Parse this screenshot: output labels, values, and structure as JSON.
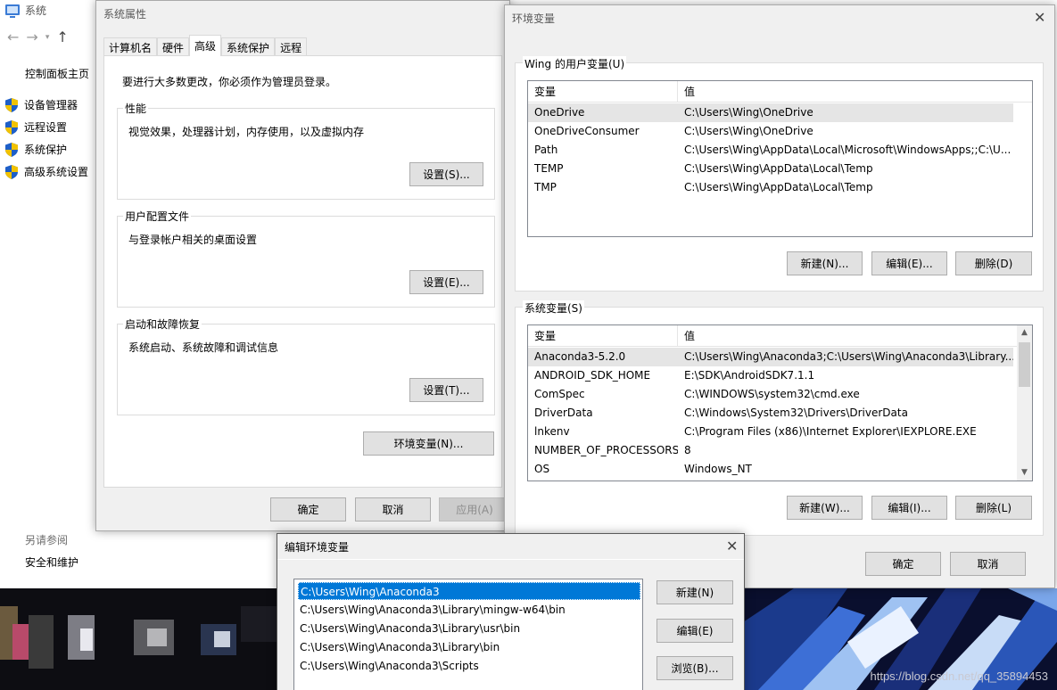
{
  "control_panel": {
    "title": "系统",
    "home_link": "控制面板主页",
    "links": [
      "设备管理器",
      "远程设置",
      "系统保护",
      "高级系统设置"
    ],
    "see_also": "另请参阅",
    "security_link": "安全和维护"
  },
  "system_properties": {
    "title": "系统属性",
    "tabs": [
      "计算机名",
      "硬件",
      "高级",
      "系统保护",
      "远程"
    ],
    "active_tab": "高级",
    "admin_note": "要进行大多数更改，你必须作为管理员登录。",
    "performance": {
      "label": "性能",
      "description": "视觉效果，处理器计划，内存使用，以及虚拟内存",
      "button": "设置(S)..."
    },
    "user_profiles": {
      "label": "用户配置文件",
      "description": "与登录帐户相关的桌面设置",
      "button": "设置(E)..."
    },
    "startup_recovery": {
      "label": "启动和故障恢复",
      "description": "系统启动、系统故障和调试信息",
      "button": "设置(T)..."
    },
    "env_button": "环境变量(N)...",
    "ok": "确定",
    "cancel": "取消",
    "apply": "应用(A)"
  },
  "environment_variables": {
    "title": "环境变量",
    "user_section": "Wing 的用户变量(U)",
    "user_headers": {
      "variable": "变量",
      "value": "值"
    },
    "user_vars": [
      {
        "name": "OneDrive",
        "value": "C:\\Users\\Wing\\OneDrive"
      },
      {
        "name": "OneDriveConsumer",
        "value": "C:\\Users\\Wing\\OneDrive"
      },
      {
        "name": "Path",
        "value": "C:\\Users\\Wing\\AppData\\Local\\Microsoft\\WindowsApps;;C:\\U..."
      },
      {
        "name": "TEMP",
        "value": "C:\\Users\\Wing\\AppData\\Local\\Temp"
      },
      {
        "name": "TMP",
        "value": "C:\\Users\\Wing\\AppData\\Local\\Temp"
      }
    ],
    "user_buttons": {
      "new": "新建(N)...",
      "edit": "编辑(E)...",
      "delete": "删除(D)"
    },
    "system_section": "系统变量(S)",
    "system_headers": {
      "variable": "变量",
      "value": "值"
    },
    "system_vars": [
      {
        "name": "Anaconda3-5.2.0",
        "value": "C:\\Users\\Wing\\Anaconda3;C:\\Users\\Wing\\Anaconda3\\Library..."
      },
      {
        "name": "ANDROID_SDK_HOME",
        "value": "E:\\SDK\\AndroidSDK7.1.1"
      },
      {
        "name": "ComSpec",
        "value": "C:\\WINDOWS\\system32\\cmd.exe"
      },
      {
        "name": "DriverData",
        "value": "C:\\Windows\\System32\\Drivers\\DriverData"
      },
      {
        "name": "lnkenv",
        "value": "C:\\Program Files (x86)\\Internet Explorer\\IEXPLORE.EXE"
      },
      {
        "name": "NUMBER_OF_PROCESSORS",
        "value": "8"
      },
      {
        "name": "OS",
        "value": "Windows_NT"
      }
    ],
    "system_buttons": {
      "new": "新建(W)...",
      "edit": "编辑(I)...",
      "delete": "删除(L)"
    },
    "ok": "确定",
    "cancel": "取消"
  },
  "edit_env_var": {
    "title": "编辑环境变量",
    "entries": [
      "C:\\Users\\Wing\\Anaconda3",
      "C:\\Users\\Wing\\Anaconda3\\Library\\mingw-w64\\bin",
      "C:\\Users\\Wing\\Anaconda3\\Library\\usr\\bin",
      "C:\\Users\\Wing\\Anaconda3\\Library\\bin",
      "C:\\Users\\Wing\\Anaconda3\\Scripts"
    ],
    "selected_index": 0,
    "buttons": {
      "new": "新建(N)",
      "edit": "编辑(E)",
      "browse": "浏览(B)..."
    }
  },
  "desktop": {
    "watermark": "https://blog.csdn.net/qq_35894453"
  },
  "colors": {
    "selection_blue": "#0078d7",
    "window_bg": "#f0f0f0",
    "shield_blue": "#1e5fc8",
    "shield_yellow": "#f2c200"
  }
}
